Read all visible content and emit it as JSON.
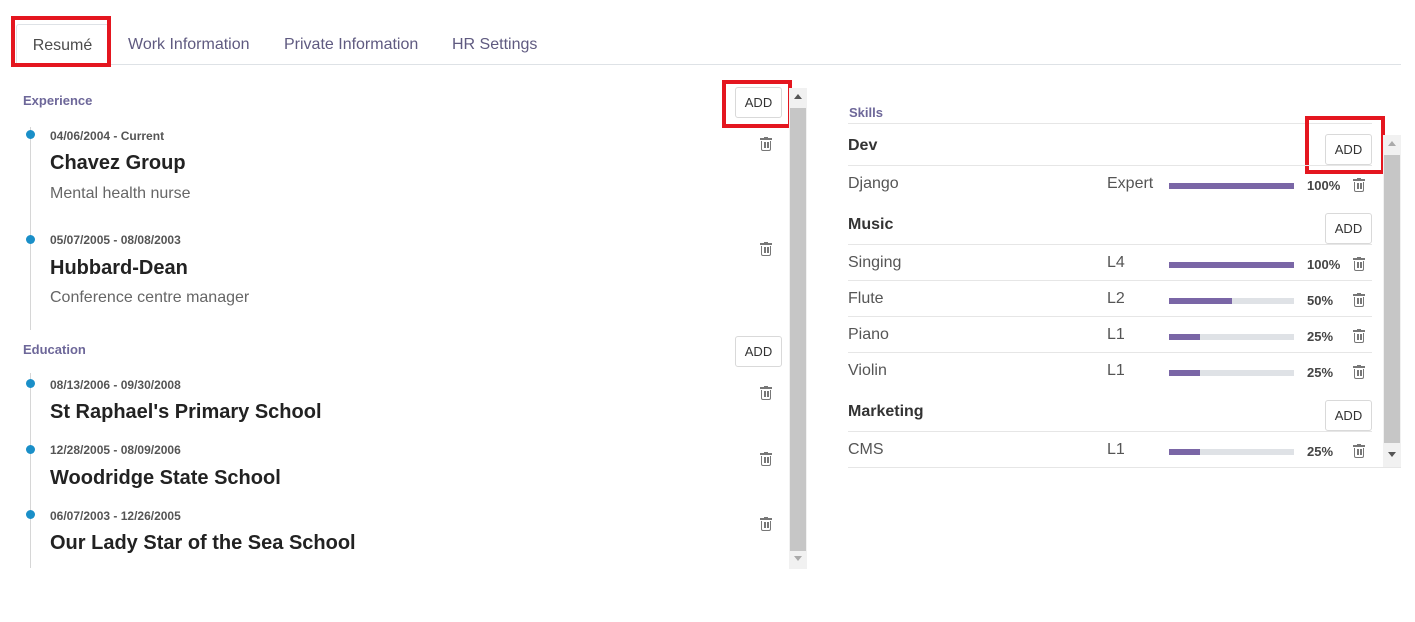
{
  "tabs": [
    {
      "label": "Resumé"
    },
    {
      "label": "Work Information"
    },
    {
      "label": "Private Information"
    },
    {
      "label": "HR Settings"
    }
  ],
  "resume": {
    "experience": {
      "title": "Experience",
      "add_label": "ADD",
      "items": [
        {
          "dates": "04/06/2004 - Current",
          "name": "Chavez Group",
          "description": "Mental health nurse"
        },
        {
          "dates": "05/07/2005 - 08/08/2003",
          "name": "Hubbard-Dean",
          "description": "Conference centre manager"
        }
      ]
    },
    "education": {
      "title": "Education",
      "add_label": "ADD",
      "items": [
        {
          "dates": "08/13/2006 - 09/30/2008",
          "name": "St Raphael's Primary School"
        },
        {
          "dates": "12/28/2005 - 08/09/2006",
          "name": "Woodridge State School"
        },
        {
          "dates": "06/07/2003 - 12/26/2005",
          "name": "Our Lady Star of the Sea School"
        }
      ]
    }
  },
  "skills": {
    "title": "Skills",
    "groups": [
      {
        "name": "Dev",
        "add_label": "ADD",
        "items": [
          {
            "name": "Django",
            "level": "Expert",
            "progress": 100,
            "percent": "100%"
          }
        ]
      },
      {
        "name": "Music",
        "add_label": "ADD",
        "items": [
          {
            "name": "Singing",
            "level": "L4",
            "progress": 100,
            "percent": "100%"
          },
          {
            "name": "Flute",
            "level": "L2",
            "progress": 50,
            "percent": "50%"
          },
          {
            "name": "Piano",
            "level": "L1",
            "progress": 25,
            "percent": "25%"
          },
          {
            "name": "Violin",
            "level": "L1",
            "progress": 25,
            "percent": "25%"
          }
        ]
      },
      {
        "name": "Marketing",
        "add_label": "ADD",
        "items": [
          {
            "name": "CMS",
            "level": "L1",
            "progress": 25,
            "percent": "25%"
          }
        ]
      }
    ]
  },
  "colors": {
    "accent": "#7a66a6",
    "timeline_dot": "#1a8fc8",
    "highlight": "#e4161f"
  }
}
